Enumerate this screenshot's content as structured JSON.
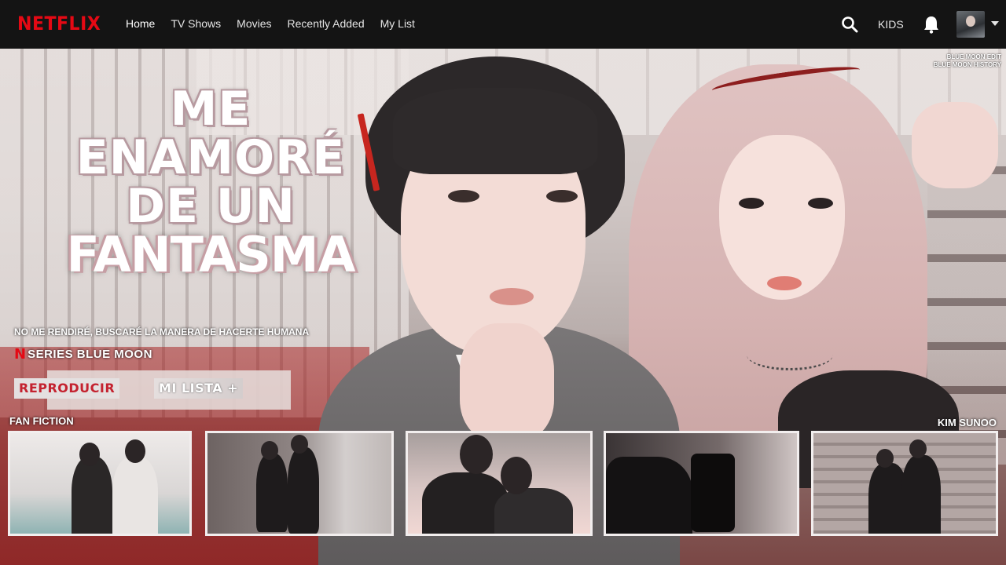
{
  "brand": {
    "logo": "NETFLIX",
    "color": "#e50914"
  },
  "nav": {
    "items": [
      {
        "label": "Home"
      },
      {
        "label": "TV Shows"
      },
      {
        "label": "Movies"
      },
      {
        "label": "Recently Added"
      },
      {
        "label": "My List"
      }
    ],
    "kids": "KIDS",
    "icons": [
      "search-icon",
      "bell-icon",
      "profile-avatar",
      "caret-down-icon"
    ]
  },
  "hero": {
    "title_lines": [
      "ME",
      "ENAMORÉ",
      "DE UN",
      "FANTASMA"
    ],
    "tagline": "NO ME RENDIRÉ, BUSCARÉ LA MANERA DE HACERTE HUMANA",
    "series_mark": "N",
    "series_label": "SERIES BLUE MOON",
    "play_button": "REPRODUCIR",
    "list_button": "MI LISTA +",
    "watermark": [
      "BLUE MOON EDIT",
      "BLUE MOON HISTORY"
    ]
  },
  "rows": {
    "left_label": "FAN FICTION",
    "right_label": "KIM SUNOO",
    "thumbnails": [
      {
        "name": "thumbnail-couple-sofa"
      },
      {
        "name": "thumbnail-couple-wall"
      },
      {
        "name": "thumbnail-couple-kiss"
      },
      {
        "name": "thumbnail-mask-selfie"
      },
      {
        "name": "thumbnail-couple-stairs"
      }
    ]
  }
}
